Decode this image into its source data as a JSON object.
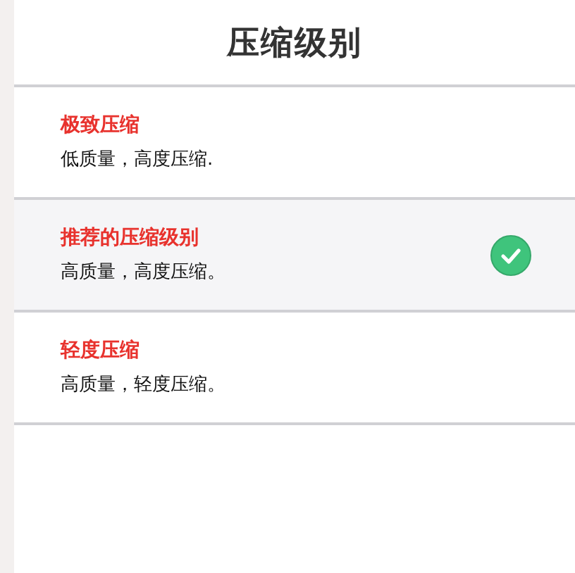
{
  "title": "压缩级别",
  "options": [
    {
      "label": "极致压缩",
      "description": "低质量，高度压缩.",
      "selected": false
    },
    {
      "label": "推荐的压缩级别",
      "description": "高质量，高度压缩。",
      "selected": true
    },
    {
      "label": "轻度压缩",
      "description": "高质量，轻度压缩。",
      "selected": false
    }
  ]
}
